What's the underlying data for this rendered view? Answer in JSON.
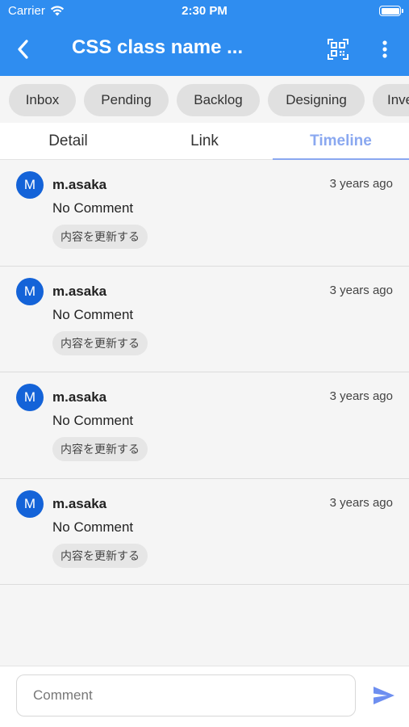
{
  "status_bar": {
    "carrier": "Carrier",
    "time": "2:30 PM"
  },
  "app_bar": {
    "title": "CSS class name ...",
    "icons": {
      "back": "chevron-left-icon",
      "qr": "qr-scan-icon",
      "more": "more-vertical-icon"
    }
  },
  "colors": {
    "app_bar": "#2f8df0",
    "active_tab": "#8aa8f0",
    "avatar": "#1463d8",
    "send": "#6e8ff0"
  },
  "chips": [
    {
      "label": "Inbox"
    },
    {
      "label": "Pending"
    },
    {
      "label": "Backlog"
    },
    {
      "label": "Designing"
    },
    {
      "label": "Inve"
    }
  ],
  "tabs": [
    {
      "label": "Detail"
    },
    {
      "label": "Link"
    },
    {
      "label": "Timeline"
    }
  ],
  "active_tab": "Timeline",
  "timeline": [
    {
      "avatar": "M",
      "user": "m.asaka",
      "time": "3 years ago",
      "comment": "No Comment",
      "action": "内容を更新する"
    },
    {
      "avatar": "M",
      "user": "m.asaka",
      "time": "3 years ago",
      "comment": "No Comment",
      "action": "内容を更新する"
    },
    {
      "avatar": "M",
      "user": "m.asaka",
      "time": "3 years ago",
      "comment": "No Comment",
      "action": "内容を更新する"
    },
    {
      "avatar": "M",
      "user": "m.asaka",
      "time": "3 years ago",
      "comment": "No Comment",
      "action": "内容を更新する"
    }
  ],
  "comment_box": {
    "placeholder": "Comment",
    "value": "",
    "send_icon": "send-icon"
  }
}
